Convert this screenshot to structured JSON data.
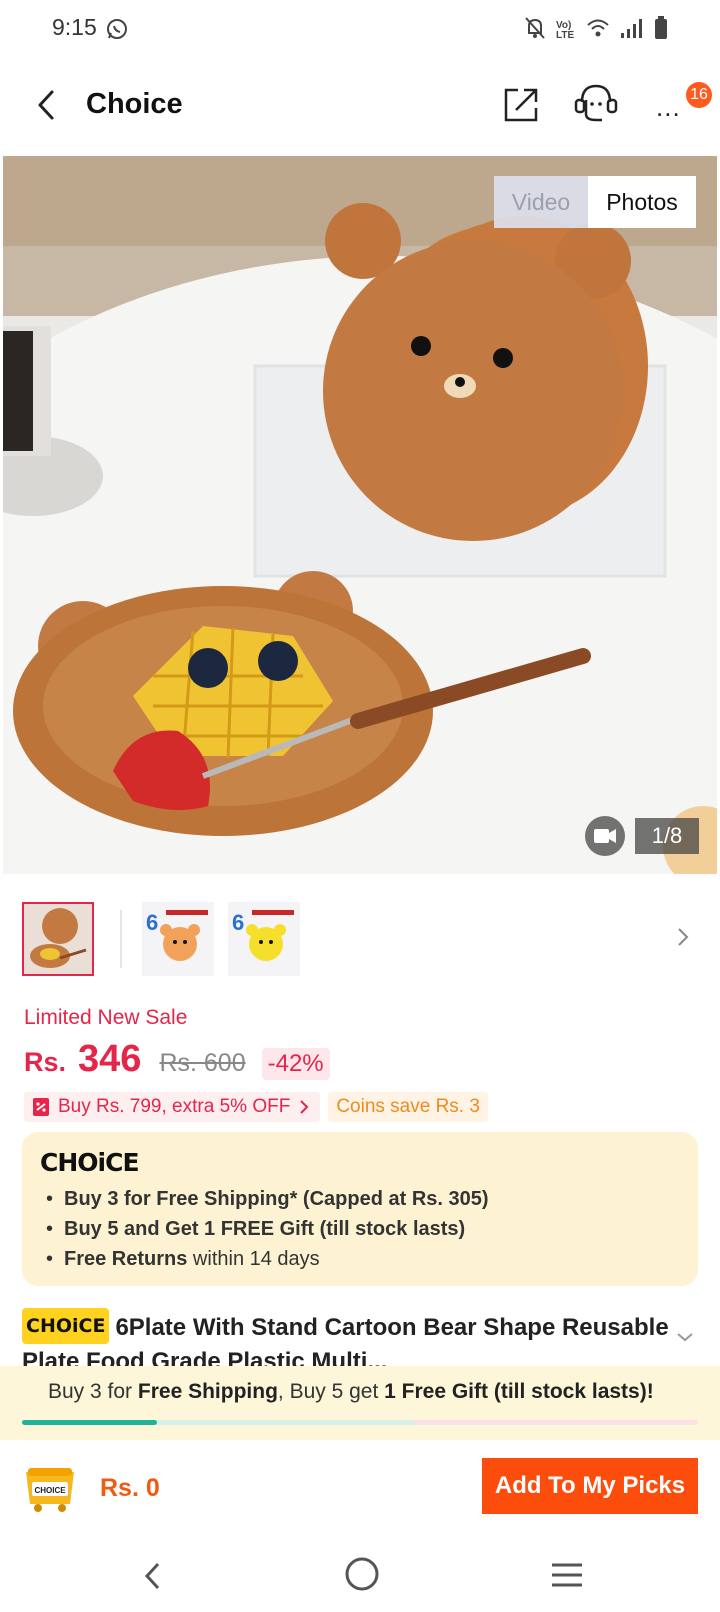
{
  "status_bar": {
    "time": "9:15",
    "network": "Vo) LTE"
  },
  "header": {
    "title": "Choice",
    "more_glyph": "...",
    "notification_count": "16"
  },
  "gallery": {
    "tab_video": "Video",
    "tab_photos": "Photos",
    "counter": "1/8",
    "thumb_label": "6"
  },
  "price": {
    "sale_label": "Limited New Sale",
    "currency": "Rs.",
    "current": "346",
    "original": "Rs. 600",
    "discount": "-42%"
  },
  "promos": {
    "coupon": "Buy Rs. 799, extra 5% OFF",
    "coins": "Coins save Rs. 3"
  },
  "choice_card": {
    "logo": "CHOiCE",
    "items": [
      {
        "bold": "Buy 3 for  Free Shipping* (Capped at Rs. 305)",
        "rest": ""
      },
      {
        "bold": "Buy 5 and Get 1 FREE Gift (till stock lasts)",
        "rest": ""
      },
      {
        "bold": "Free Returns",
        "rest": " within 14 days"
      }
    ]
  },
  "product": {
    "badge": "CHOiCE",
    "title": "6Plate With Stand Cartoon Bear Shape Reusable Plate Food Grade Plastic Multi..."
  },
  "shipping_bar": {
    "t1": "Buy 3 for ",
    "b1": "Free Shipping",
    "t2": ", Buy 5 get ",
    "b2": "1 Free Gift (till stock lasts)!",
    "progress": 0.2
  },
  "action_bar": {
    "cart_label": "CHOICE",
    "total": "Rs. 0",
    "add_button": "Add To My Picks"
  },
  "colors": {
    "accent": "#e5254a",
    "button": "#fc4d0c",
    "progress": "#1fb39a"
  }
}
